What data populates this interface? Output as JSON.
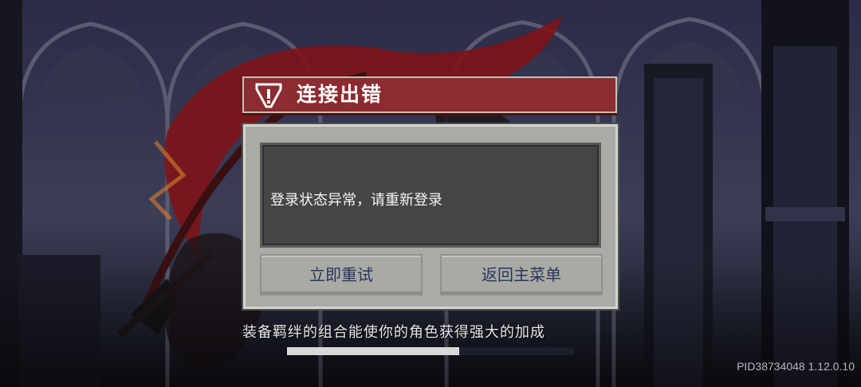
{
  "dialog": {
    "title": "连接出错",
    "message": "登录状态异常，请重新登录",
    "retry_label": "立即重试",
    "menu_label": "返回主菜单"
  },
  "loading": {
    "tip": "装备羁绊的组合能使你的角色获得强大的加成",
    "progress_fraction": 0.6
  },
  "footer": {
    "version": "PID38734048 1.12.0.10"
  },
  "colors": {
    "title_bar": "#8c2b30",
    "panel": "#a9aba4",
    "message_box": "#444547",
    "button_text": "#283660"
  },
  "icons": {
    "title": "warning-icon"
  }
}
